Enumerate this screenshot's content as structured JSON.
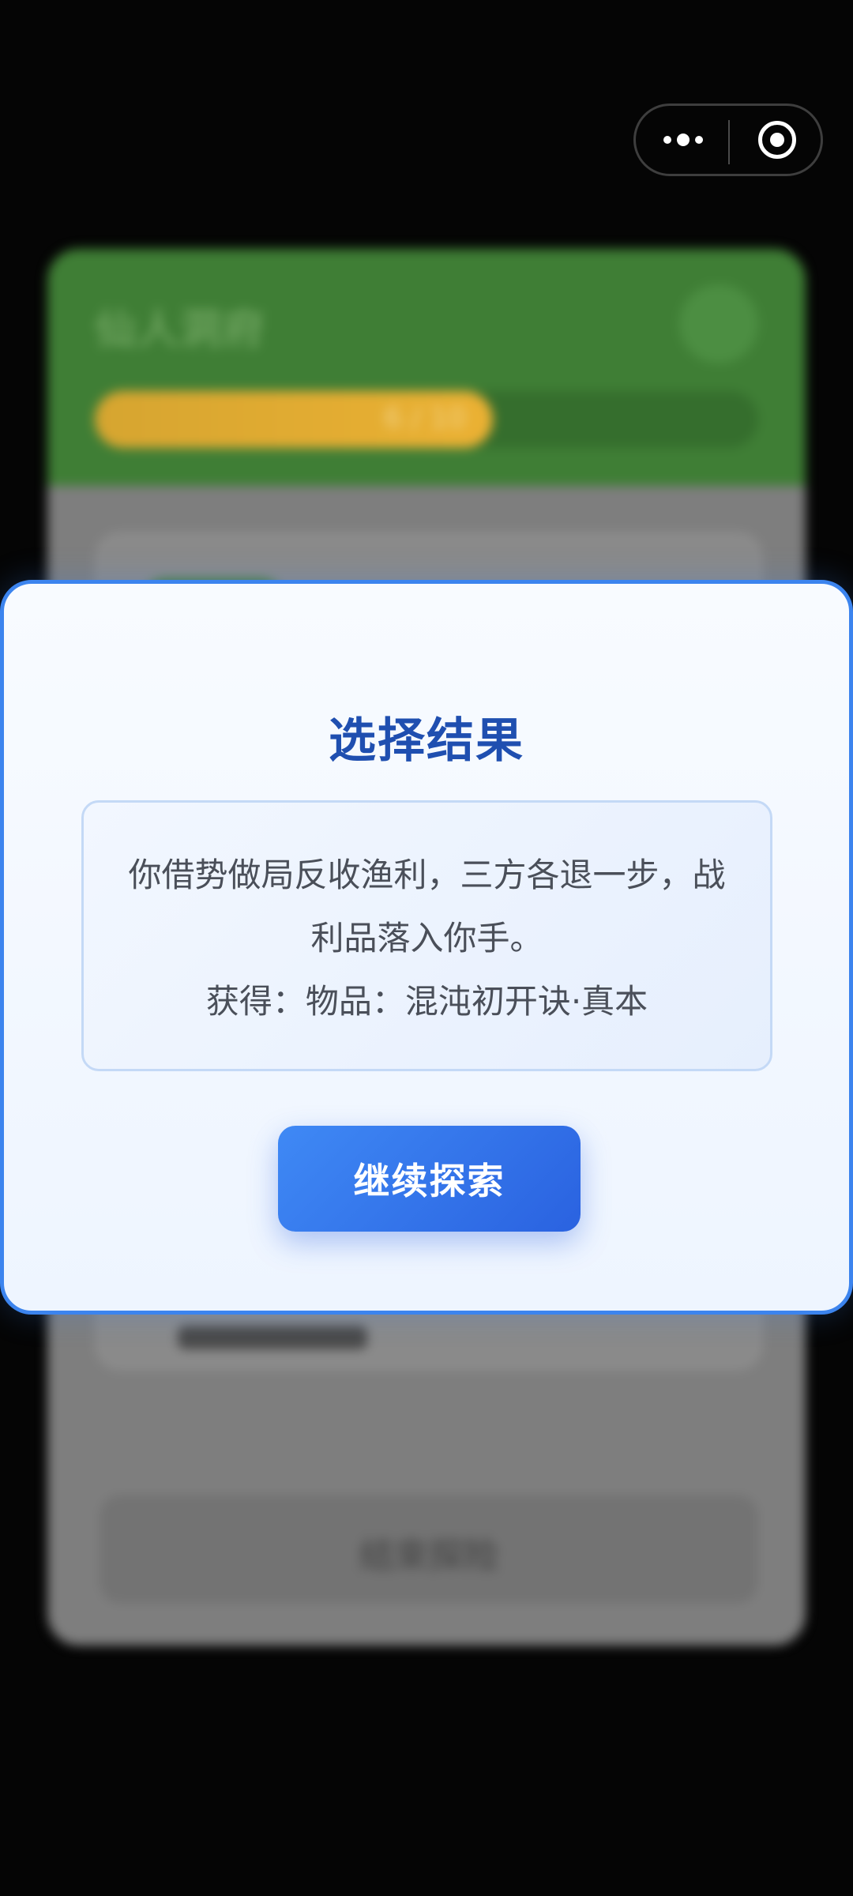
{
  "background_app": {
    "card_title": "仙人洞府",
    "progress_text": "6 / 10",
    "progress_fraction": 0.6,
    "end_button_label": "结束探险"
  },
  "capsule": {
    "more_icon": "more-dots-icon",
    "close_icon": "target-close-icon"
  },
  "modal": {
    "title": "选择结果",
    "description": "你借势做局反收渔利，三方各退一步，战利品落入你手。",
    "reward": "获得：物品：混沌初开诀·真本",
    "continue_label": "继续探索"
  },
  "colors": {
    "modal_border": "#3c84ee",
    "title": "#1f4fb0",
    "button": "#2f6fe8",
    "header_green": "#3f7e35",
    "progress_gold": "#ebb133"
  }
}
